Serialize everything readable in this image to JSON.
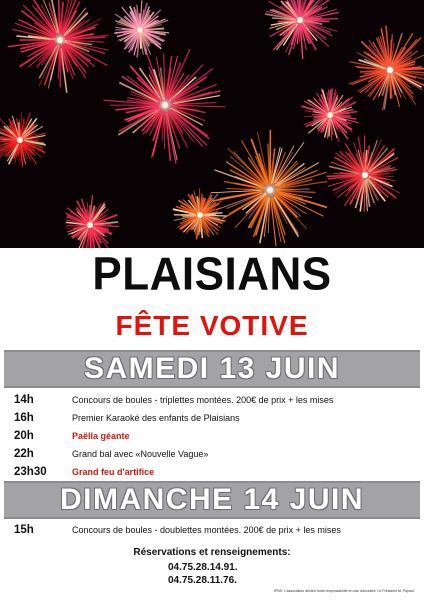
{
  "poster": {
    "town": "PLAISIANS",
    "subtitle": "FÊTE VOTIVE",
    "colors": {
      "title": "#0d0d0d",
      "accent_red": "#e3120b",
      "band_gray": "#a3a3a6",
      "band_text": "#ffffff"
    }
  },
  "saturday": {
    "heading": "SAMEDI 13 JUIN",
    "events": [
      {
        "time": "14h",
        "text": "Concours de boules - triplettes montées. 200€ de prix + les mises",
        "highlight": false
      },
      {
        "time": "16h",
        "text": "Premier Karaoké des enfants de Plaisians",
        "highlight": false
      },
      {
        "time": "20h",
        "text": "Paëlla géante",
        "highlight": true
      },
      {
        "time": "22h",
        "text": "Grand bal avec «Nouvelle Vague»",
        "highlight": false
      },
      {
        "time": "23h30",
        "text": "Grand feu d'artifice",
        "highlight": true
      }
    ]
  },
  "sunday": {
    "heading": "DIMANCHE 14 JUIN",
    "events": [
      {
        "time": "15h",
        "text": "Concours de boules - doublettes montées. 200€ de prix + les mises",
        "highlight": false
      }
    ]
  },
  "contact": {
    "label": "Réservations et renseignements:",
    "phones": [
      "04.75.28.14.91.",
      "04.75.28.11.76."
    ],
    "footnote": "IPNS. L'association décline toute responsabilité en cas d'accident. Le Président M. Payard"
  }
}
